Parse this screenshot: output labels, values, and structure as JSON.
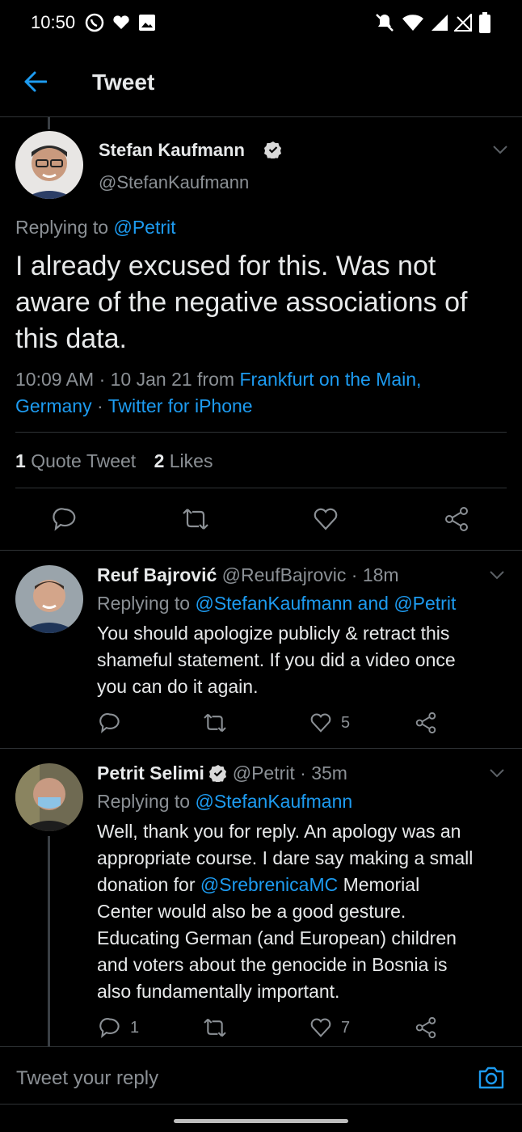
{
  "status_bar": {
    "time": "10:50",
    "left_icons": [
      "viber-icon",
      "heart-icon",
      "image-icon"
    ],
    "right_icons": [
      "mute-icon",
      "wifi-icon",
      "signal-icon",
      "no-signal-icon",
      "battery-icon"
    ]
  },
  "header": {
    "back_icon": "arrow-left-icon",
    "title": "Tweet"
  },
  "main_tweet": {
    "author_name": "Stefan Kaufmann",
    "handle": "@StefanKaufmann",
    "verified": true,
    "replying_prefix": "Replying to",
    "replying_to": "@Petrit",
    "text": "I already excused for this. Was not aware of the negative associations of this data.",
    "meta_time": "10:09 AM · 10 Jan 21 from ",
    "meta_location_line1": "Frankfurt on the Main,",
    "meta_location_line2": "Germany",
    "meta_sep": " · ",
    "meta_client": "Twitter for iPhone",
    "quote_count": "1",
    "quote_label": "Quote Tweet",
    "likes_count": "2",
    "likes_label": "Likes"
  },
  "replies": [
    {
      "author_name": "Reuf Bajrović",
      "handle_time": "@ReufBajrovic · 18m",
      "verified": false,
      "replying_prefix": "Replying to",
      "replying_to": "@StefanKaufmann and @Petrit",
      "lines": [
        "You should apologize publicly & retract this",
        "shameful statement. If you did a video once",
        "you can do it again."
      ],
      "reply_count": "",
      "like_count": "5"
    },
    {
      "author_name": "Petrit Selimi",
      "handle_time": "@Petrit · 35m",
      "verified": true,
      "replying_prefix": "Replying to",
      "replying_to": "@StefanKaufmann",
      "lines_before_mention": [
        "Well, thank you for reply. An apology was an",
        "appropriate course. I dare say making a small",
        "donation for "
      ],
      "mention": "@SrebrenicaMC",
      "mention_after": " Memorial",
      "lines_after": [
        "Center would also be a good gesture.",
        "Educating German (and European) children",
        "and voters about the genocide in Bosnia is",
        "also fundamentally important."
      ],
      "reply_count": "1",
      "like_count": "7"
    }
  ],
  "compose": {
    "placeholder": "Tweet your reply",
    "camera_icon": "camera-icon"
  },
  "colors": {
    "background": "#000000",
    "accent": "#1d9bf0",
    "secondary_text": "#8b9095",
    "divider": "#2f3336"
  }
}
